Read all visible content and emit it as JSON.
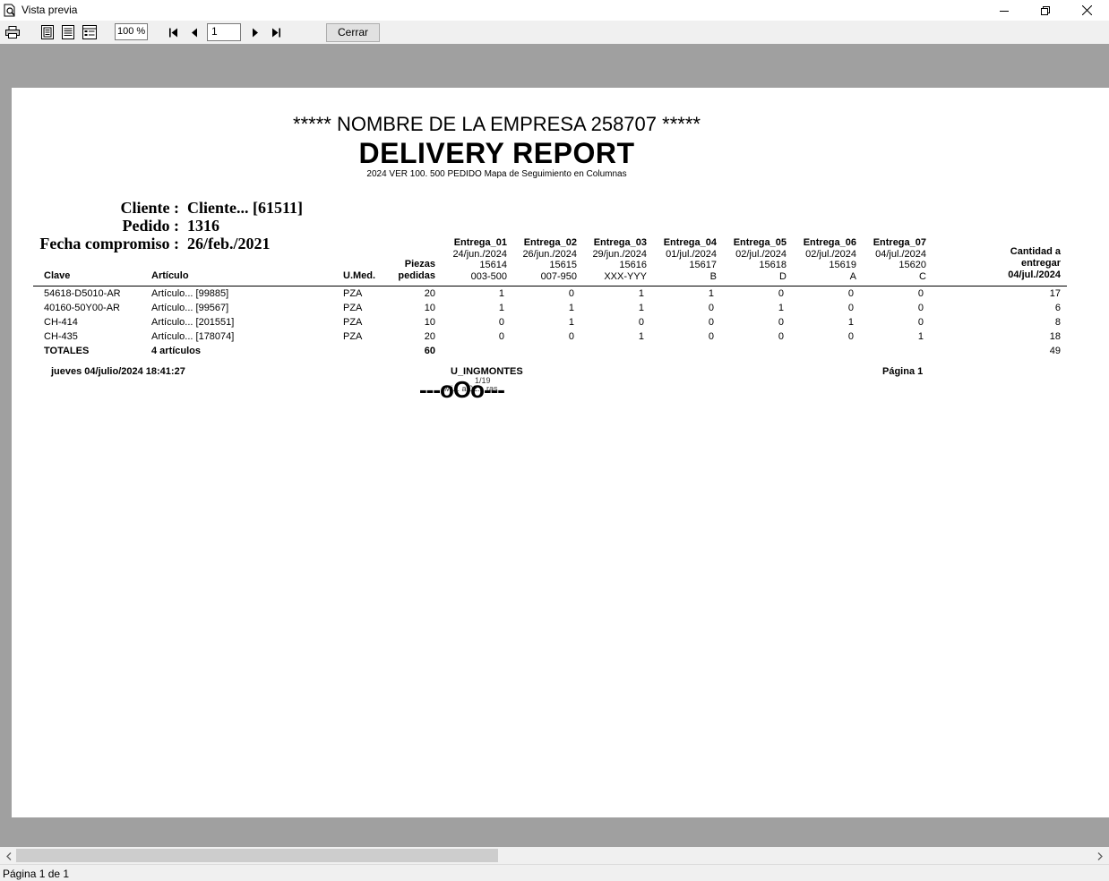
{
  "window": {
    "title": "Vista previa"
  },
  "toolbar": {
    "zoom_value": "100 %",
    "page_value": "1",
    "close_label": "Cerrar"
  },
  "report": {
    "company": "***** NOMBRE DE LA EMPRESA 258707 *****",
    "title": "DELIVERY REPORT",
    "subtitle": "2024 VER 100. 500 PEDIDO Mapa de Seguimiento en Columnas",
    "header": {
      "cliente_label": "Cliente :",
      "cliente_value": "Cliente... [61511]",
      "pedido_label": "Pedido :",
      "pedido_value": "1316",
      "fecha_label": "Fecha compromiso :",
      "fecha_value": "26/feb./2021"
    },
    "columns": {
      "clave": "Clave",
      "articulo": "Artículo",
      "umed": "U.Med.",
      "piezas_1": "Piezas",
      "piezas_2": "pedidas",
      "cantidad_1": "Cantidad a",
      "cantidad_2": "entregar",
      "cantidad_3": "04/jul./2024"
    },
    "entregas": [
      {
        "name": "Entrega_01",
        "date": "24/jun./2024",
        "num": "15614",
        "code": "003-500"
      },
      {
        "name": "Entrega_02",
        "date": "26/jun./2024",
        "num": "15615",
        "code": "007-950"
      },
      {
        "name": "Entrega_03",
        "date": "29/jun./2024",
        "num": "15616",
        "code": "XXX-YYY"
      },
      {
        "name": "Entrega_04",
        "date": "01/jul./2024",
        "num": "15617",
        "code": "B"
      },
      {
        "name": "Entrega_05",
        "date": "02/jul./2024",
        "num": "15618",
        "code": "D"
      },
      {
        "name": "Entrega_06",
        "date": "02/jul./2024",
        "num": "15619",
        "code": "A"
      },
      {
        "name": "Entrega_07",
        "date": "04/jul./2024",
        "num": "15620",
        "code": "C"
      }
    ],
    "rows": [
      {
        "clave": "54618-D5010-AR",
        "articulo": "Artículo... [99885]",
        "umed": "PZA",
        "piezas": "20",
        "e": [
          "1",
          "0",
          "1",
          "1",
          "0",
          "0",
          "0"
        ],
        "cantidad": "17"
      },
      {
        "clave": "40160-50Y00-AR",
        "articulo": "Artículo... [99567]",
        "umed": "PZA",
        "piezas": "10",
        "e": [
          "1",
          "1",
          "1",
          "0",
          "1",
          "0",
          "0"
        ],
        "cantidad": "6"
      },
      {
        "clave": "CH-414",
        "articulo": "Artículo... [201551]",
        "umed": "PZA",
        "piezas": "10",
        "e": [
          "0",
          "1",
          "0",
          "0",
          "0",
          "1",
          "0"
        ],
        "cantidad": "8"
      },
      {
        "clave": "CH-435",
        "articulo": "Artículo... [178074]",
        "umed": "PZA",
        "piezas": "20",
        "e": [
          "0",
          "0",
          "1",
          "0",
          "0",
          "0",
          "1"
        ],
        "cantidad": "18"
      }
    ],
    "totals": {
      "label": "TOTALES",
      "articulos": "4 artículos",
      "piezas": "60",
      "cantidad": "49"
    },
    "footer": {
      "datetime": "jueves 04/julio/2024 18:41:27",
      "user": "U_INGMONTES",
      "page": "Página 1",
      "end_marker": "---oOo---",
      "overlap_1": "1/19",
      "overlap_2": "Mi... a 02... ras"
    }
  },
  "status": {
    "text": "Página 1 de 1"
  }
}
